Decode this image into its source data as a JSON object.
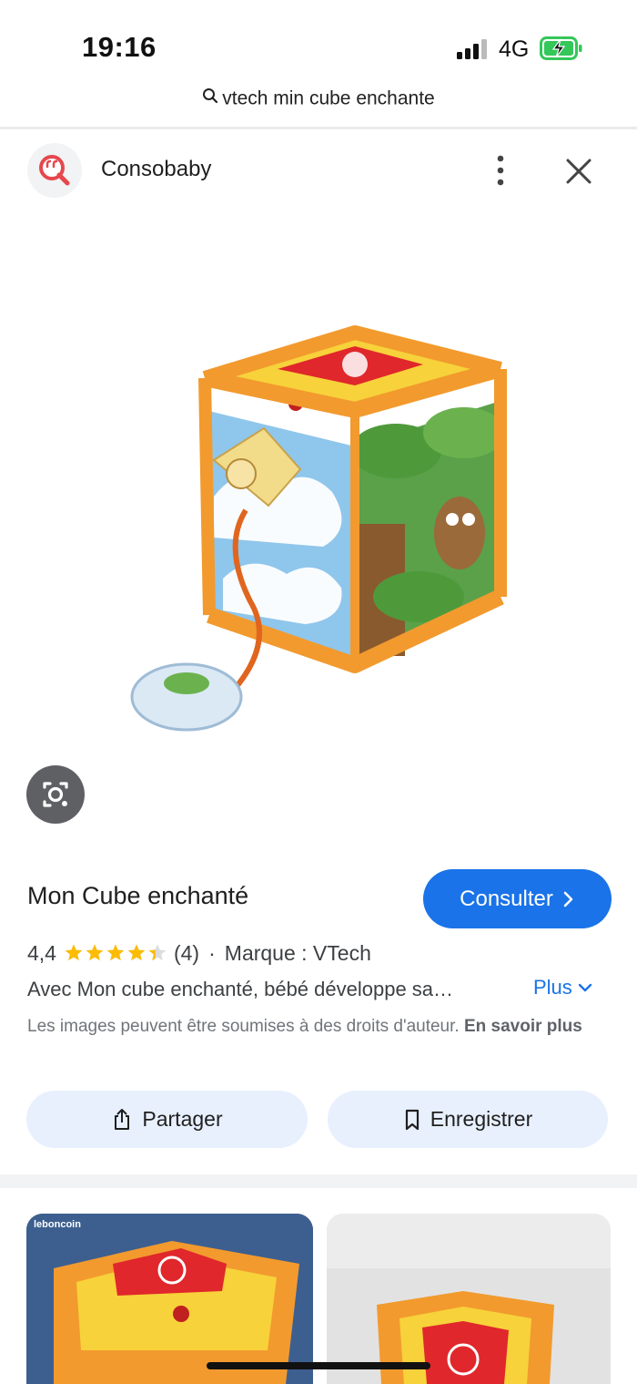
{
  "status_bar": {
    "time": "19:16",
    "network": "4G"
  },
  "url_bar": {
    "query": "vtech min cube enchante"
  },
  "source": {
    "name": "Consobaby"
  },
  "product": {
    "title": "Mon Cube enchanté",
    "consult_label": "Consulter",
    "rating_value": "4,4",
    "rating_stars": 4.4,
    "review_count": "(4)",
    "separator": "·",
    "brand": "Marque : VTech",
    "description": "Avec Mon cube enchanté, bébé développe sa…",
    "more_label": "Plus",
    "copyright_notice": "Les images peuvent être soumises à des droits d'auteur.",
    "learn_more_label": "En savoir plus"
  },
  "actions": {
    "share_label": "Partager",
    "save_label": "Enregistrer"
  },
  "related": {
    "thumb_1_source": "leboncoin"
  },
  "colors": {
    "accent": "#1a73e8",
    "star": "#fbbc04",
    "action_bg": "#e8f0fe"
  }
}
